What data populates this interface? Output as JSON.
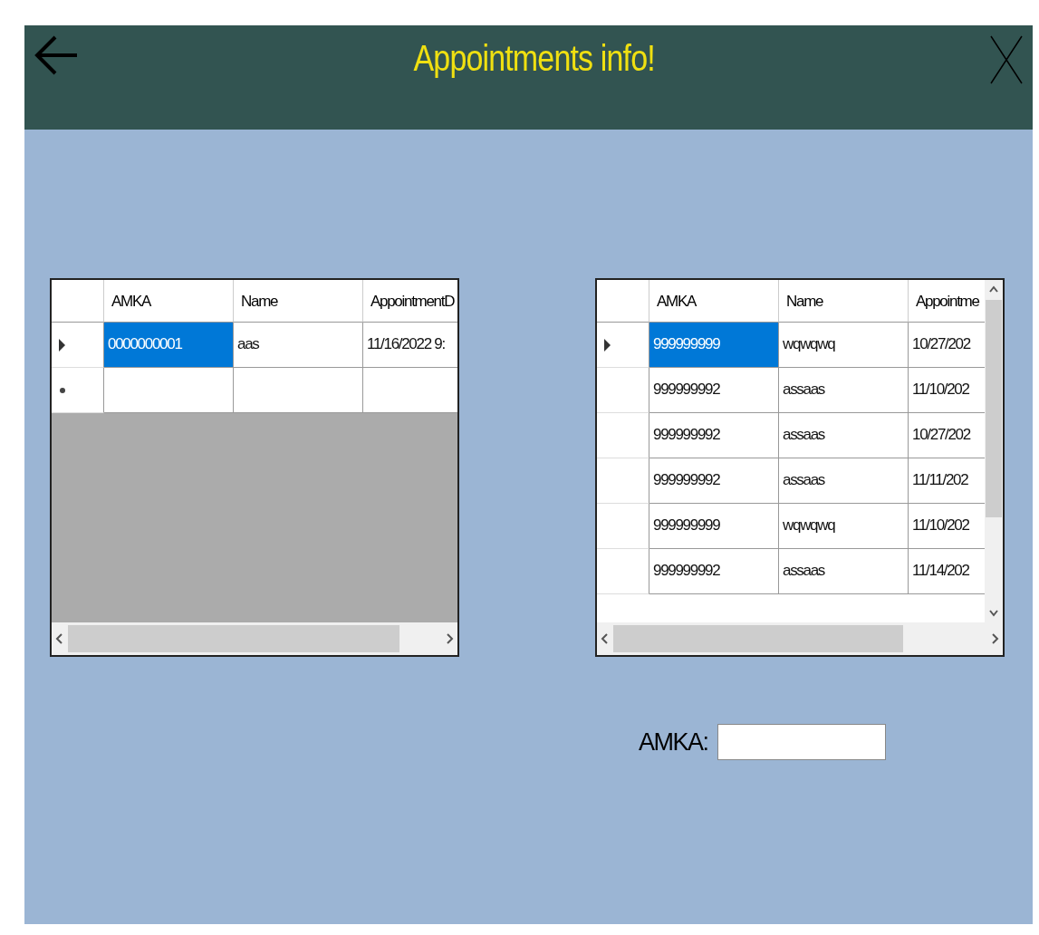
{
  "header": {
    "title": "Appointments info!"
  },
  "grids": [
    {
      "columns": [
        "AMKA",
        "Name",
        "AppointmentD"
      ],
      "rows": [
        {
          "kind": "data",
          "selected": true,
          "cells": [
            "0000000001",
            "aas",
            "11/16/2022 9:"
          ]
        },
        {
          "kind": "new",
          "selected": false,
          "cells": [
            "",
            "",
            ""
          ]
        }
      ],
      "vertical_scroll": false
    },
    {
      "columns": [
        "AMKA",
        "Name",
        "Appointme"
      ],
      "rows": [
        {
          "kind": "data",
          "selected": true,
          "cells": [
            "999999999",
            "wqwqwq",
            "10/27/202"
          ]
        },
        {
          "kind": "data",
          "selected": false,
          "cells": [
            "999999992",
            "assaas",
            "11/10/202"
          ]
        },
        {
          "kind": "data",
          "selected": false,
          "cells": [
            "999999992",
            "assaas",
            "10/27/202"
          ]
        },
        {
          "kind": "data",
          "selected": false,
          "cells": [
            "999999992",
            "assaas",
            "11/11/202"
          ]
        },
        {
          "kind": "data",
          "selected": false,
          "cells": [
            "999999999",
            "wqwqwq",
            "11/10/202"
          ]
        },
        {
          "kind": "data",
          "selected": false,
          "cells": [
            "999999992",
            "assaas",
            "11/14/202"
          ]
        }
      ],
      "vertical_scroll": true
    }
  ],
  "amka_field": {
    "label": "AMKA:"
  }
}
